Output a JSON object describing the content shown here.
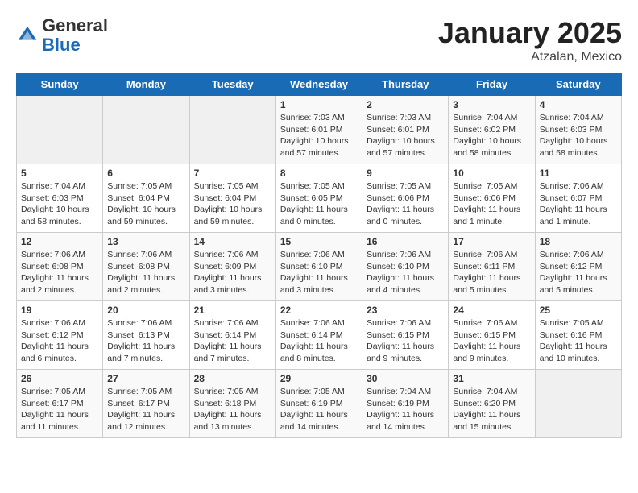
{
  "header": {
    "logo_line1": "General",
    "logo_line2": "Blue",
    "month_title": "January 2025",
    "subtitle": "Atzalan, Mexico"
  },
  "weekdays": [
    "Sunday",
    "Monday",
    "Tuesday",
    "Wednesday",
    "Thursday",
    "Friday",
    "Saturday"
  ],
  "weeks": [
    [
      {
        "day": "",
        "info": ""
      },
      {
        "day": "",
        "info": ""
      },
      {
        "day": "",
        "info": ""
      },
      {
        "day": "1",
        "info": "Sunrise: 7:03 AM\nSunset: 6:01 PM\nDaylight: 10 hours and 57 minutes."
      },
      {
        "day": "2",
        "info": "Sunrise: 7:03 AM\nSunset: 6:01 PM\nDaylight: 10 hours and 57 minutes."
      },
      {
        "day": "3",
        "info": "Sunrise: 7:04 AM\nSunset: 6:02 PM\nDaylight: 10 hours and 58 minutes."
      },
      {
        "day": "4",
        "info": "Sunrise: 7:04 AM\nSunset: 6:03 PM\nDaylight: 10 hours and 58 minutes."
      }
    ],
    [
      {
        "day": "5",
        "info": "Sunrise: 7:04 AM\nSunset: 6:03 PM\nDaylight: 10 hours and 58 minutes."
      },
      {
        "day": "6",
        "info": "Sunrise: 7:05 AM\nSunset: 6:04 PM\nDaylight: 10 hours and 59 minutes."
      },
      {
        "day": "7",
        "info": "Sunrise: 7:05 AM\nSunset: 6:04 PM\nDaylight: 10 hours and 59 minutes."
      },
      {
        "day": "8",
        "info": "Sunrise: 7:05 AM\nSunset: 6:05 PM\nDaylight: 11 hours and 0 minutes."
      },
      {
        "day": "9",
        "info": "Sunrise: 7:05 AM\nSunset: 6:06 PM\nDaylight: 11 hours and 0 minutes."
      },
      {
        "day": "10",
        "info": "Sunrise: 7:05 AM\nSunset: 6:06 PM\nDaylight: 11 hours and 1 minute."
      },
      {
        "day": "11",
        "info": "Sunrise: 7:06 AM\nSunset: 6:07 PM\nDaylight: 11 hours and 1 minute."
      }
    ],
    [
      {
        "day": "12",
        "info": "Sunrise: 7:06 AM\nSunset: 6:08 PM\nDaylight: 11 hours and 2 minutes."
      },
      {
        "day": "13",
        "info": "Sunrise: 7:06 AM\nSunset: 6:08 PM\nDaylight: 11 hours and 2 minutes."
      },
      {
        "day": "14",
        "info": "Sunrise: 7:06 AM\nSunset: 6:09 PM\nDaylight: 11 hours and 3 minutes."
      },
      {
        "day": "15",
        "info": "Sunrise: 7:06 AM\nSunset: 6:10 PM\nDaylight: 11 hours and 3 minutes."
      },
      {
        "day": "16",
        "info": "Sunrise: 7:06 AM\nSunset: 6:10 PM\nDaylight: 11 hours and 4 minutes."
      },
      {
        "day": "17",
        "info": "Sunrise: 7:06 AM\nSunset: 6:11 PM\nDaylight: 11 hours and 5 minutes."
      },
      {
        "day": "18",
        "info": "Sunrise: 7:06 AM\nSunset: 6:12 PM\nDaylight: 11 hours and 5 minutes."
      }
    ],
    [
      {
        "day": "19",
        "info": "Sunrise: 7:06 AM\nSunset: 6:12 PM\nDaylight: 11 hours and 6 minutes."
      },
      {
        "day": "20",
        "info": "Sunrise: 7:06 AM\nSunset: 6:13 PM\nDaylight: 11 hours and 7 minutes."
      },
      {
        "day": "21",
        "info": "Sunrise: 7:06 AM\nSunset: 6:14 PM\nDaylight: 11 hours and 7 minutes."
      },
      {
        "day": "22",
        "info": "Sunrise: 7:06 AM\nSunset: 6:14 PM\nDaylight: 11 hours and 8 minutes."
      },
      {
        "day": "23",
        "info": "Sunrise: 7:06 AM\nSunset: 6:15 PM\nDaylight: 11 hours and 9 minutes."
      },
      {
        "day": "24",
        "info": "Sunrise: 7:06 AM\nSunset: 6:15 PM\nDaylight: 11 hours and 9 minutes."
      },
      {
        "day": "25",
        "info": "Sunrise: 7:05 AM\nSunset: 6:16 PM\nDaylight: 11 hours and 10 minutes."
      }
    ],
    [
      {
        "day": "26",
        "info": "Sunrise: 7:05 AM\nSunset: 6:17 PM\nDaylight: 11 hours and 11 minutes."
      },
      {
        "day": "27",
        "info": "Sunrise: 7:05 AM\nSunset: 6:17 PM\nDaylight: 11 hours and 12 minutes."
      },
      {
        "day": "28",
        "info": "Sunrise: 7:05 AM\nSunset: 6:18 PM\nDaylight: 11 hours and 13 minutes."
      },
      {
        "day": "29",
        "info": "Sunrise: 7:05 AM\nSunset: 6:19 PM\nDaylight: 11 hours and 14 minutes."
      },
      {
        "day": "30",
        "info": "Sunrise: 7:04 AM\nSunset: 6:19 PM\nDaylight: 11 hours and 14 minutes."
      },
      {
        "day": "31",
        "info": "Sunrise: 7:04 AM\nSunset: 6:20 PM\nDaylight: 11 hours and 15 minutes."
      },
      {
        "day": "",
        "info": ""
      }
    ]
  ]
}
